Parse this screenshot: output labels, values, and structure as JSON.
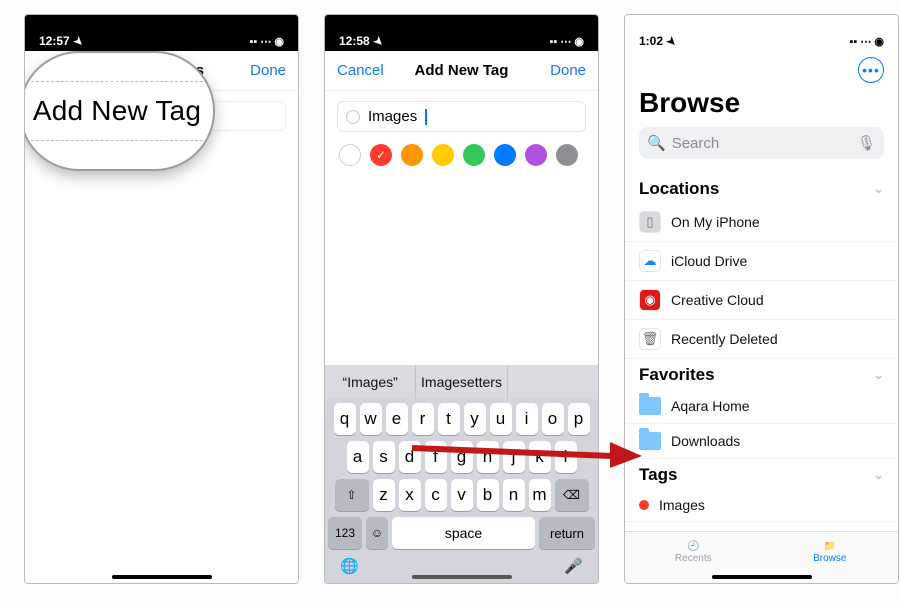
{
  "panel1": {
    "time": "12:57",
    "nav_title_partial": "gs",
    "done": "Done",
    "magnified_text": "Add New Tag"
  },
  "panel2": {
    "time": "12:58",
    "cancel": "Cancel",
    "title": "Add New Tag",
    "done": "Done",
    "tag_value": "Images",
    "colors": [
      {
        "hex": "#ffffff",
        "hollow": true,
        "checked": false
      },
      {
        "hex": "#ff3b30",
        "hollow": false,
        "checked": true
      },
      {
        "hex": "#ff9500",
        "hollow": false,
        "checked": false
      },
      {
        "hex": "#ffcc00",
        "hollow": false,
        "checked": false
      },
      {
        "hex": "#34c759",
        "hollow": false,
        "checked": false
      },
      {
        "hex": "#007aff",
        "hollow": false,
        "checked": false
      },
      {
        "hex": "#af52de",
        "hollow": false,
        "checked": false
      },
      {
        "hex": "#8e8e93",
        "hollow": false,
        "checked": false
      }
    ],
    "suggestions": [
      "“Images”",
      "Imagesetters",
      ""
    ],
    "rows": [
      [
        "q",
        "w",
        "e",
        "r",
        "t",
        "y",
        "u",
        "i",
        "o",
        "p"
      ],
      [
        "a",
        "s",
        "d",
        "f",
        "g",
        "h",
        "j",
        "k",
        "l"
      ],
      [
        "z",
        "x",
        "c",
        "v",
        "b",
        "n",
        "m"
      ]
    ],
    "key_123": "123",
    "key_space": "space",
    "key_return": "return"
  },
  "panel3": {
    "time": "1:02",
    "title": "Browse",
    "search_placeholder": "Search",
    "sections": {
      "locations": {
        "header": "Locations",
        "items": [
          {
            "label": "On My iPhone",
            "icon": "phone",
            "bg": "#d8d9dd",
            "fg": "#6e6f74"
          },
          {
            "label": "iCloud Drive",
            "icon": "cloud",
            "bg": "#ffffff",
            "fg": "#0a84ff"
          },
          {
            "label": "Creative Cloud",
            "icon": "cc",
            "bg": "#da1b1b",
            "fg": "#ffffff"
          },
          {
            "label": "Recently Deleted",
            "icon": "trash",
            "bg": "#ffffff",
            "fg": "#6e6f74"
          }
        ]
      },
      "favorites": {
        "header": "Favorites",
        "items": [
          {
            "label": "Aqara Home"
          },
          {
            "label": "Downloads"
          }
        ]
      },
      "tags": {
        "header": "Tags",
        "items": [
          {
            "label": "Images",
            "color": "#ff3b30"
          }
        ]
      }
    },
    "tabs": {
      "recents": "Recents",
      "browse": "Browse"
    }
  }
}
